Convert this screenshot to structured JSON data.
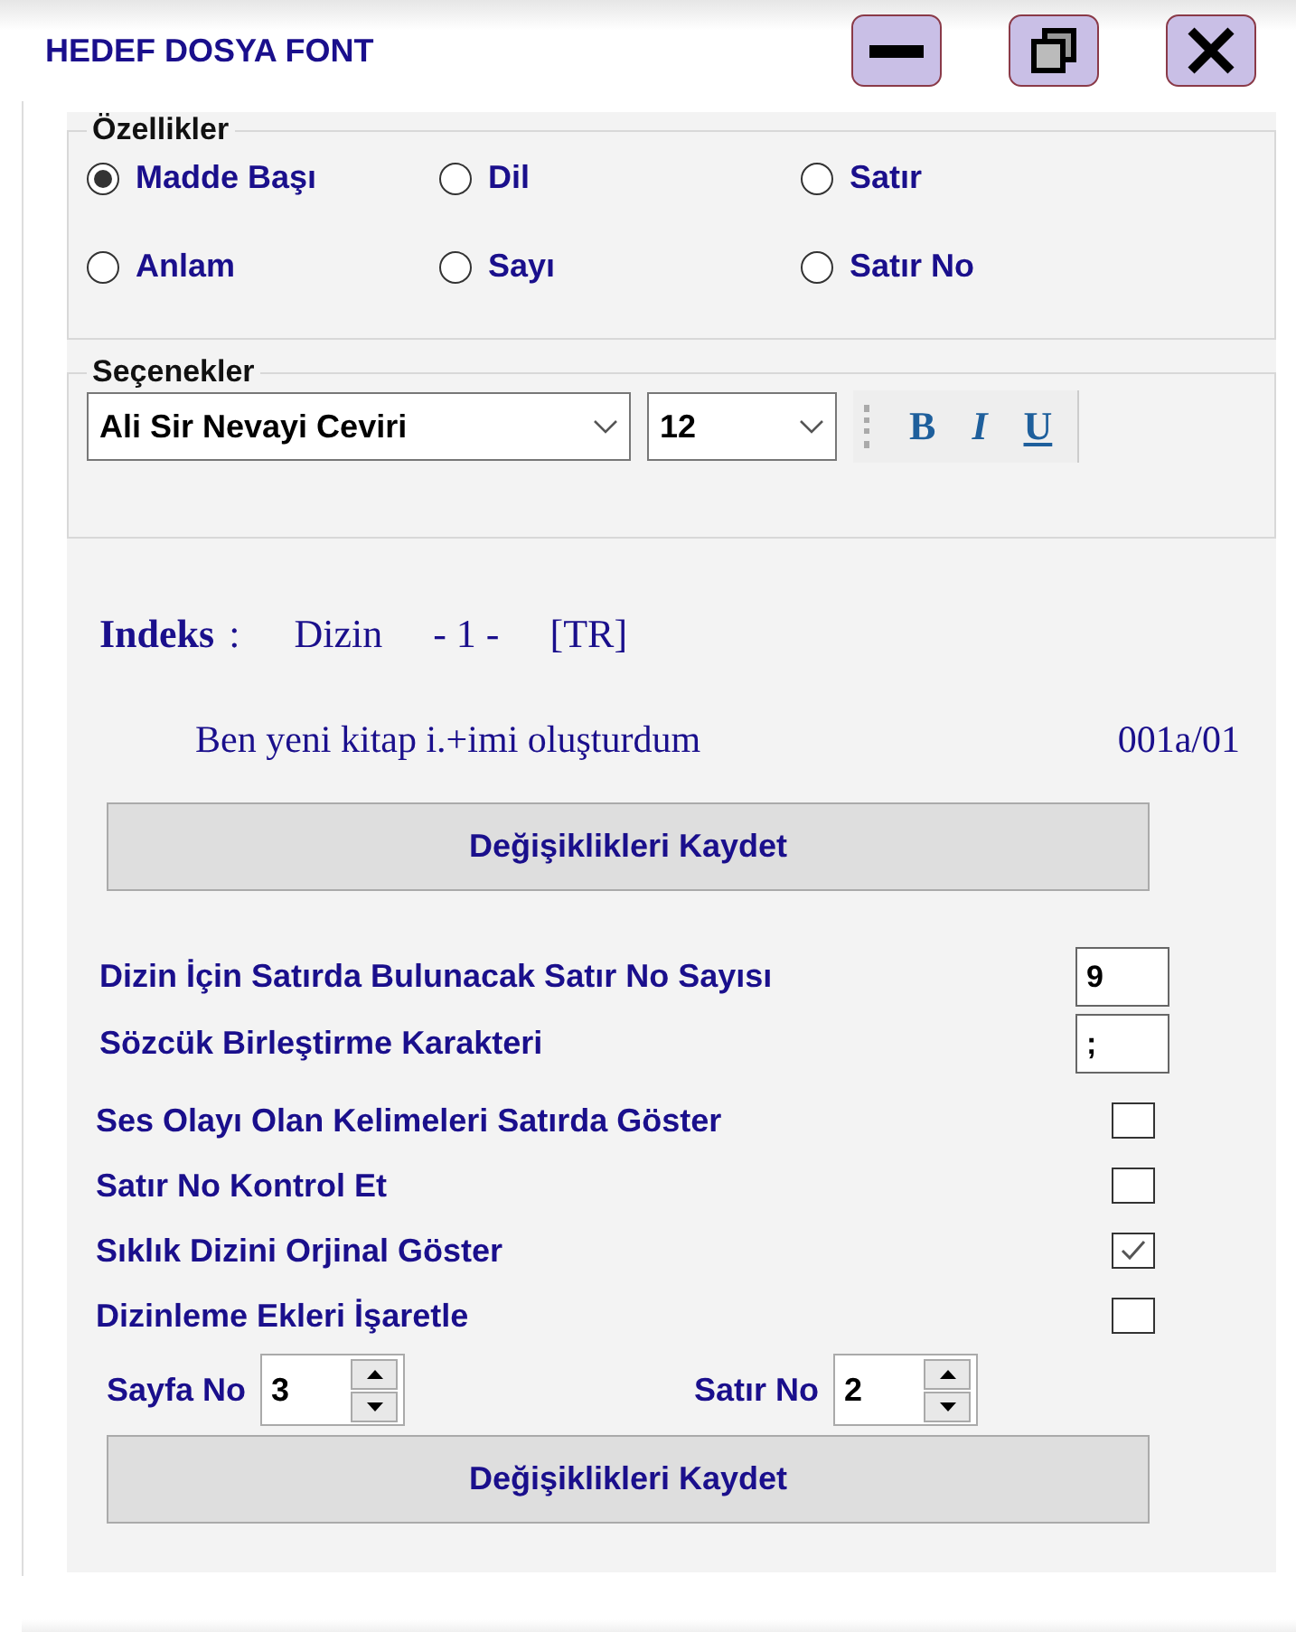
{
  "window": {
    "title": "HEDEF DOSYA FONT"
  },
  "features": {
    "legend": "Özellikler",
    "options": [
      {
        "label": "Madde Başı",
        "selected": true
      },
      {
        "label": "Dil",
        "selected": false
      },
      {
        "label": "Satır",
        "selected": false
      },
      {
        "label": "Anlam",
        "selected": false
      },
      {
        "label": "Sayı",
        "selected": false
      },
      {
        "label": "Satır No",
        "selected": false
      }
    ]
  },
  "options": {
    "legend": "Seçenekler",
    "font": "Ali Sir Nevayi Ceviri",
    "size": "12",
    "format_buttons": [
      "B",
      "I",
      "U"
    ]
  },
  "index": {
    "label": "Indeks",
    "separator": ":",
    "parts": [
      "Dizin",
      "- 1 -",
      "[TR]"
    ]
  },
  "sample": {
    "text": "Ben yeni kitap i.+imi oluşturdum",
    "code": "001a/01"
  },
  "save_top": "Değişiklikleri Kaydet",
  "fields": [
    {
      "label": "Dizin İçin Satırda Bulunacak Satır No Sayısı",
      "value": "9"
    },
    {
      "label": "Sözcük Birleştirme Karakteri",
      "value": ";"
    }
  ],
  "checks": [
    {
      "label": "Ses Olayı Olan Kelimeleri Satırda Göster",
      "checked": false
    },
    {
      "label": "Satır No Kontrol Et",
      "checked": false
    },
    {
      "label": "Sıklık Dizini Orjinal Göster",
      "checked": true
    },
    {
      "label": "Dizinleme Ekleri İşaretle",
      "checked": false
    }
  ],
  "spinners": [
    {
      "label": "Sayfa No",
      "value": "3"
    },
    {
      "label": "Satır No",
      "value": "2"
    }
  ],
  "save_bottom": "Değişiklikleri Kaydet"
}
